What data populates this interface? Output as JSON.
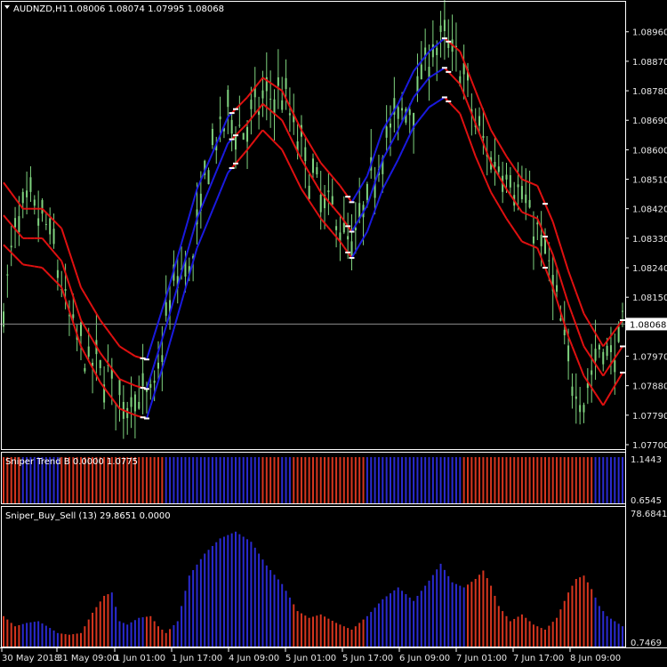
{
  "colors": {
    "background": "#000000",
    "candle": "#7fd37f",
    "upper_band": "#e01010",
    "lower_band": "#1a1ae0",
    "trend_red": "#d6351e",
    "trend_blue": "#2a2ad0",
    "frame": "#ffffff",
    "current_line": "#8c8c8c"
  },
  "header": {
    "symbol": "AUDNZD,H1",
    "ohlc": "1.08006 1.08074 1.07995 1.08068",
    "arrow_icon": "triangle-down-icon"
  },
  "chart_data": [
    {
      "type": "line",
      "panel": "main",
      "title": "",
      "price_axis": [
        "1.08960",
        "1.08870",
        "1.08780",
        "1.08690",
        "1.08600",
        "1.08510",
        "1.08420",
        "1.08330",
        "1.08240",
        "1.08150",
        "1.07970",
        "1.07880",
        "1.07790",
        "1.07700"
      ],
      "current_price": "1.08068",
      "ylim": [
        1.077,
        1.09
      ],
      "x_ticks": [
        "30 May 2018",
        "31 May 09:00",
        "1 Jun 01:00",
        "1 Jun 17:00",
        "4 Jun 09:00",
        "5 Jun 01:00",
        "5 Jun 17:00",
        "6 Jun 09:00",
        "7 Jun 01:00",
        "7 Jun 17:00",
        "8 Jun 09:00"
      ],
      "price_path": [
        [
          0,
          1.0811
        ],
        [
          3,
          1.0836
        ],
        [
          7,
          1.0843
        ],
        [
          12,
          1.0835
        ],
        [
          17,
          1.0808
        ],
        [
          22,
          1.0795
        ],
        [
          27,
          1.0792
        ],
        [
          31,
          1.0781
        ],
        [
          33,
          1.0786
        ],
        [
          36,
          1.0784
        ],
        [
          39,
          1.0785
        ],
        [
          42,
          1.0808
        ],
        [
          45,
          1.0822
        ],
        [
          49,
          1.0826
        ],
        [
          53,
          1.0858
        ],
        [
          58,
          1.087
        ],
        [
          62,
          1.0866
        ],
        [
          67,
          1.0875
        ],
        [
          72,
          1.0878
        ],
        [
          77,
          1.086
        ],
        [
          82,
          1.0845
        ],
        [
          86,
          1.084
        ],
        [
          90,
          1.0829
        ],
        [
          94,
          1.0845
        ],
        [
          98,
          1.0862
        ],
        [
          102,
          1.087
        ],
        [
          106,
          1.0875
        ],
        [
          110,
          1.089
        ],
        [
          114,
          1.0893
        ],
        [
          118,
          1.0887
        ],
        [
          122,
          1.0868
        ],
        [
          126,
          1.0857
        ],
        [
          130,
          1.0855
        ],
        [
          134,
          1.0845
        ],
        [
          138,
          1.0835
        ],
        [
          142,
          1.082
        ],
        [
          146,
          1.0793
        ],
        [
          150,
          1.0784
        ],
        [
          154,
          1.08
        ],
        [
          158,
          1.0797
        ],
        [
          160,
          1.0806
        ]
      ],
      "bands": {
        "upper": [
          [
            0,
            1.085
          ],
          [
            5,
            1.0842
          ],
          [
            10,
            1.0842
          ],
          [
            15,
            1.0836
          ],
          [
            20,
            1.0818
          ],
          [
            25,
            1.0808
          ],
          [
            30,
            1.08
          ],
          [
            34,
            1.0797
          ],
          [
            37,
            1.0796
          ],
          [
            42,
            1.0815
          ],
          [
            50,
            1.0848
          ],
          [
            58,
            1.087
          ],
          [
            63,
            1.0876
          ],
          [
            67,
            1.0882
          ],
          [
            72,
            1.0878
          ],
          [
            77,
            1.0866
          ],
          [
            82,
            1.0856
          ],
          [
            87,
            1.0849
          ],
          [
            90,
            1.0844
          ],
          [
            94,
            1.0852
          ],
          [
            98,
            1.0866
          ],
          [
            102,
            1.0874
          ],
          [
            106,
            1.0884
          ],
          [
            110,
            1.089
          ],
          [
            114,
            1.0894
          ],
          [
            118,
            1.089
          ],
          [
            122,
            1.0878
          ],
          [
            126,
            1.0866
          ],
          [
            130,
            1.0858
          ],
          [
            134,
            1.0851
          ],
          [
            138,
            1.0849
          ],
          [
            142,
            1.0838
          ],
          [
            146,
            1.0823
          ],
          [
            150,
            1.081
          ],
          [
            155,
            1.08
          ],
          [
            160,
            1.0808
          ]
        ],
        "middle": [
          [
            0,
            1.084
          ],
          [
            5,
            1.0833
          ],
          [
            10,
            1.0833
          ],
          [
            15,
            1.0826
          ],
          [
            20,
            1.0808
          ],
          [
            25,
            1.0798
          ],
          [
            30,
            1.079
          ],
          [
            34,
            1.0788
          ],
          [
            37,
            1.0787
          ],
          [
            42,
            1.0806
          ],
          [
            50,
            1.0839
          ],
          [
            58,
            1.0862
          ],
          [
            63,
            1.0868
          ],
          [
            67,
            1.0874
          ],
          [
            72,
            1.0869
          ],
          [
            77,
            1.0857
          ],
          [
            82,
            1.0847
          ],
          [
            87,
            1.084
          ],
          [
            90,
            1.0835
          ],
          [
            94,
            1.0843
          ],
          [
            98,
            1.0857
          ],
          [
            102,
            1.0866
          ],
          [
            106,
            1.0876
          ],
          [
            110,
            1.0882
          ],
          [
            114,
            1.0885
          ],
          [
            118,
            1.088
          ],
          [
            122,
            1.0868
          ],
          [
            126,
            1.0856
          ],
          [
            130,
            1.0848
          ],
          [
            134,
            1.0841
          ],
          [
            138,
            1.0839
          ],
          [
            142,
            1.0828
          ],
          [
            146,
            1.0813
          ],
          [
            150,
            1.08
          ],
          [
            155,
            1.0791
          ],
          [
            160,
            1.08
          ]
        ],
        "lower": [
          [
            0,
            1.0831
          ],
          [
            5,
            1.0825
          ],
          [
            10,
            1.0824
          ],
          [
            15,
            1.0818
          ],
          [
            20,
            1.08
          ],
          [
            25,
            1.0789
          ],
          [
            30,
            1.0781
          ],
          [
            34,
            1.0779
          ],
          [
            37,
            1.0778
          ],
          [
            42,
            1.0797
          ],
          [
            50,
            1.083
          ],
          [
            58,
            1.0853
          ],
          [
            63,
            1.086
          ],
          [
            67,
            1.0866
          ],
          [
            72,
            1.086
          ],
          [
            77,
            1.0848
          ],
          [
            82,
            1.0839
          ],
          [
            87,
            1.0832
          ],
          [
            90,
            1.0827
          ],
          [
            94,
            1.0835
          ],
          [
            98,
            1.0848
          ],
          [
            102,
            1.0857
          ],
          [
            106,
            1.0867
          ],
          [
            110,
            1.0873
          ],
          [
            114,
            1.0876
          ],
          [
            118,
            1.0871
          ],
          [
            122,
            1.0858
          ],
          [
            126,
            1.0847
          ],
          [
            130,
            1.0839
          ],
          [
            134,
            1.0832
          ],
          [
            138,
            1.083
          ],
          [
            142,
            1.0818
          ],
          [
            146,
            1.0803
          ],
          [
            150,
            1.0791
          ],
          [
            155,
            1.0782
          ],
          [
            160,
            1.0792
          ]
        ],
        "blue_segments": [
          [
            37,
            59
          ],
          [
            90,
            114
          ]
        ]
      }
    },
    {
      "type": "bar",
      "panel": "trend",
      "title": "Sniper Trend B 0.0000 1.0775",
      "ylim_labels": [
        "1.1443",
        "0.6545"
      ],
      "segments": [
        {
          "from": 0,
          "to": 4,
          "color": "red"
        },
        {
          "from": 5,
          "to": 14,
          "color": "blue"
        },
        {
          "from": 15,
          "to": 41,
          "color": "red"
        },
        {
          "from": 42,
          "to": 66,
          "color": "blue"
        },
        {
          "from": 67,
          "to": 71,
          "color": "red"
        },
        {
          "from": 72,
          "to": 74,
          "color": "blue"
        },
        {
          "from": 75,
          "to": 93,
          "color": "red"
        },
        {
          "from": 94,
          "to": 118,
          "color": "blue"
        },
        {
          "from": 119,
          "to": 152,
          "color": "red"
        },
        {
          "from": 153,
          "to": 160,
          "color": "blue"
        }
      ]
    },
    {
      "type": "bar",
      "panel": "buy_sell",
      "title": "Sniper_Buy_Sell (13) 29.8651 0.0000",
      "ylim_labels": [
        "78.6841",
        "0.7469"
      ],
      "ylim": [
        0,
        80
      ],
      "profile": [
        [
          0,
          18
        ],
        [
          3,
          12
        ],
        [
          6,
          14
        ],
        [
          9,
          15
        ],
        [
          12,
          11
        ],
        [
          14,
          8
        ],
        [
          17,
          7
        ],
        [
          20,
          8
        ],
        [
          23,
          20
        ],
        [
          26,
          30
        ],
        [
          28,
          32
        ],
        [
          30,
          15
        ],
        [
          32,
          13
        ],
        [
          35,
          17
        ],
        [
          38,
          18
        ],
        [
          40,
          12
        ],
        [
          42,
          8
        ],
        [
          45,
          15
        ],
        [
          48,
          42
        ],
        [
          52,
          55
        ],
        [
          56,
          64
        ],
        [
          60,
          68
        ],
        [
          64,
          62
        ],
        [
          68,
          48
        ],
        [
          72,
          37
        ],
        [
          76,
          21
        ],
        [
          79,
          17
        ],
        [
          82,
          19
        ],
        [
          86,
          14
        ],
        [
          90,
          10
        ],
        [
          94,
          18
        ],
        [
          98,
          28
        ],
        [
          102,
          35
        ],
        [
          106,
          27
        ],
        [
          110,
          39
        ],
        [
          113,
          49
        ],
        [
          116,
          38
        ],
        [
          119,
          35
        ],
        [
          122,
          40
        ],
        [
          124,
          45
        ],
        [
          126,
          36
        ],
        [
          128,
          24
        ],
        [
          131,
          15
        ],
        [
          134,
          19
        ],
        [
          137,
          13
        ],
        [
          140,
          10
        ],
        [
          143,
          17
        ],
        [
          146,
          32
        ],
        [
          148,
          40
        ],
        [
          150,
          42
        ],
        [
          152,
          34
        ],
        [
          154,
          24
        ],
        [
          156,
          18
        ],
        [
          158,
          15
        ],
        [
          160,
          12
        ]
      ],
      "colors": [
        {
          "from": 0,
          "to": 4,
          "color": "red"
        },
        {
          "from": 5,
          "to": 14,
          "color": "blue"
        },
        {
          "from": 15,
          "to": 27,
          "color": "red"
        },
        {
          "from": 28,
          "to": 36,
          "color": "blue"
        },
        {
          "from": 37,
          "to": 43,
          "color": "red"
        },
        {
          "from": 44,
          "to": 74,
          "color": "blue"
        },
        {
          "from": 75,
          "to": 93,
          "color": "red"
        },
        {
          "from": 94,
          "to": 119,
          "color": "blue"
        },
        {
          "from": 120,
          "to": 152,
          "color": "red"
        },
        {
          "from": 153,
          "to": 160,
          "color": "blue"
        }
      ]
    }
  ]
}
